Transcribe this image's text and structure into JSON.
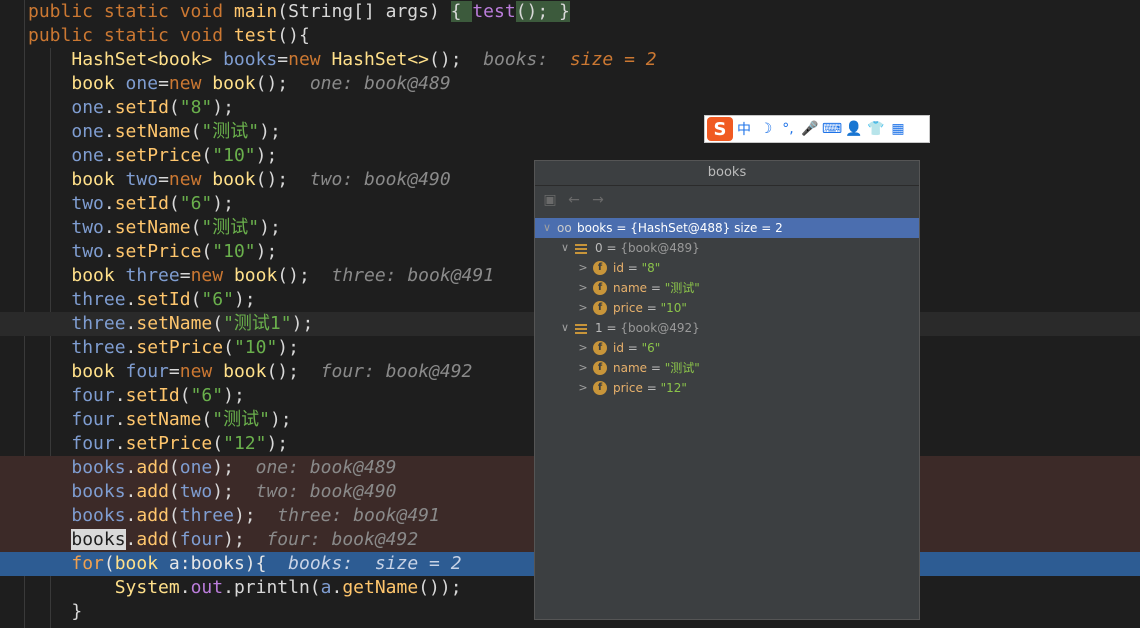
{
  "editor": {
    "lines": [
      {
        "cls": "",
        "tokens": [
          [
            "kw",
            "public "
          ],
          [
            "kw",
            "static "
          ],
          [
            "kw",
            "void "
          ],
          [
            "fn",
            "main"
          ],
          [
            "plain",
            "(String[] args) "
          ],
          [
            "fold-box",
            "{ "
          ],
          [
            "kw2",
            "test"
          ],
          [
            "fold-box",
            "();"
          ],
          [
            "fold-box",
            " }"
          ]
        ]
      },
      {
        "cls": "",
        "tokens": [
          [
            "kw",
            "public "
          ],
          [
            "kw",
            "static "
          ],
          [
            "kw",
            "void "
          ],
          [
            "fn",
            "test"
          ],
          [
            "plain",
            "(){"
          ]
        ]
      },
      {
        "cls": "",
        "tokens": [
          [
            "plain",
            "    "
          ],
          [
            "ty",
            "HashSet<book> "
          ],
          [
            "var",
            "books"
          ],
          [
            "plain",
            "="
          ],
          [
            "kw",
            "new "
          ],
          [
            "ty",
            "HashSet<>"
          ],
          [
            "plain",
            "();  "
          ],
          [
            "hint",
            "books:  "
          ],
          [
            "hint-hl",
            "size = 2"
          ]
        ]
      },
      {
        "cls": "",
        "tokens": [
          [
            "plain",
            "    "
          ],
          [
            "ty",
            "book "
          ],
          [
            "var",
            "one"
          ],
          [
            "plain",
            "="
          ],
          [
            "kw",
            "new "
          ],
          [
            "ty",
            "book"
          ],
          [
            "plain",
            "();  "
          ],
          [
            "hint",
            "one: book@489"
          ]
        ]
      },
      {
        "cls": "",
        "tokens": [
          [
            "plain",
            "    "
          ],
          [
            "var",
            "one"
          ],
          [
            "plain",
            "."
          ],
          [
            "fn",
            "setId"
          ],
          [
            "plain",
            "("
          ],
          [
            "str",
            "\"8\""
          ],
          [
            "plain",
            ");"
          ]
        ]
      },
      {
        "cls": "",
        "tokens": [
          [
            "plain",
            "    "
          ],
          [
            "var",
            "one"
          ],
          [
            "plain",
            "."
          ],
          [
            "fn",
            "setName"
          ],
          [
            "plain",
            "("
          ],
          [
            "str",
            "\"测试\""
          ],
          [
            "plain",
            ");"
          ]
        ]
      },
      {
        "cls": "",
        "tokens": [
          [
            "plain",
            "    "
          ],
          [
            "var",
            "one"
          ],
          [
            "plain",
            "."
          ],
          [
            "fn",
            "setPrice"
          ],
          [
            "plain",
            "("
          ],
          [
            "str",
            "\"10\""
          ],
          [
            "plain",
            ");"
          ]
        ]
      },
      {
        "cls": "",
        "tokens": [
          [
            "plain",
            "    "
          ],
          [
            "ty",
            "book "
          ],
          [
            "var",
            "two"
          ],
          [
            "plain",
            "="
          ],
          [
            "kw",
            "new "
          ],
          [
            "ty",
            "book"
          ],
          [
            "plain",
            "();  "
          ],
          [
            "hint",
            "two: book@490"
          ]
        ]
      },
      {
        "cls": "",
        "tokens": [
          [
            "plain",
            "    "
          ],
          [
            "var",
            "two"
          ],
          [
            "plain",
            "."
          ],
          [
            "fn",
            "setId"
          ],
          [
            "plain",
            "("
          ],
          [
            "str",
            "\"6\""
          ],
          [
            "plain",
            ");"
          ]
        ]
      },
      {
        "cls": "",
        "tokens": [
          [
            "plain",
            "    "
          ],
          [
            "var",
            "two"
          ],
          [
            "plain",
            "."
          ],
          [
            "fn",
            "setName"
          ],
          [
            "plain",
            "("
          ],
          [
            "str",
            "\"测试\""
          ],
          [
            "plain",
            ");"
          ]
        ]
      },
      {
        "cls": "",
        "tokens": [
          [
            "plain",
            "    "
          ],
          [
            "var",
            "two"
          ],
          [
            "plain",
            "."
          ],
          [
            "fn",
            "setPrice"
          ],
          [
            "plain",
            "("
          ],
          [
            "str",
            "\"10\""
          ],
          [
            "plain",
            ");"
          ]
        ]
      },
      {
        "cls": "",
        "tokens": [
          [
            "plain",
            "    "
          ],
          [
            "ty",
            "book "
          ],
          [
            "var",
            "three"
          ],
          [
            "plain",
            "="
          ],
          [
            "kw",
            "new "
          ],
          [
            "ty",
            "book"
          ],
          [
            "plain",
            "();  "
          ],
          [
            "hint",
            "three: book@491"
          ]
        ]
      },
      {
        "cls": "",
        "tokens": [
          [
            "plain",
            "    "
          ],
          [
            "var",
            "three"
          ],
          [
            "plain",
            "."
          ],
          [
            "fn",
            "setId"
          ],
          [
            "plain",
            "("
          ],
          [
            "str",
            "\"6\""
          ],
          [
            "plain",
            ");"
          ]
        ]
      },
      {
        "cls": "caret",
        "tokens": [
          [
            "plain",
            "    "
          ],
          [
            "var",
            "three"
          ],
          [
            "plain",
            "."
          ],
          [
            "fn",
            "setName"
          ],
          [
            "plain",
            "("
          ],
          [
            "str",
            "\"测试1\""
          ],
          [
            "plain",
            ");"
          ]
        ]
      },
      {
        "cls": "",
        "tokens": [
          [
            "plain",
            "    "
          ],
          [
            "var",
            "three"
          ],
          [
            "plain",
            "."
          ],
          [
            "fn",
            "setPrice"
          ],
          [
            "plain",
            "("
          ],
          [
            "str",
            "\"10\""
          ],
          [
            "plain",
            ");"
          ]
        ]
      },
      {
        "cls": "",
        "tokens": [
          [
            "plain",
            "    "
          ],
          [
            "ty",
            "book "
          ],
          [
            "var",
            "four"
          ],
          [
            "plain",
            "="
          ],
          [
            "kw",
            "new "
          ],
          [
            "ty",
            "book"
          ],
          [
            "plain",
            "();  "
          ],
          [
            "hint",
            "four: book@492"
          ]
        ]
      },
      {
        "cls": "",
        "tokens": [
          [
            "plain",
            "    "
          ],
          [
            "var",
            "four"
          ],
          [
            "plain",
            "."
          ],
          [
            "fn",
            "setId"
          ],
          [
            "plain",
            "("
          ],
          [
            "str",
            "\"6\""
          ],
          [
            "plain",
            ");"
          ]
        ]
      },
      {
        "cls": "",
        "tokens": [
          [
            "plain",
            "    "
          ],
          [
            "var",
            "four"
          ],
          [
            "plain",
            "."
          ],
          [
            "fn",
            "setName"
          ],
          [
            "plain",
            "("
          ],
          [
            "str",
            "\"测试\""
          ],
          [
            "plain",
            ");"
          ]
        ]
      },
      {
        "cls": "",
        "tokens": [
          [
            "plain",
            "    "
          ],
          [
            "var",
            "four"
          ],
          [
            "plain",
            "."
          ],
          [
            "fn",
            "setPrice"
          ],
          [
            "plain",
            "("
          ],
          [
            "str",
            "\"12\""
          ],
          [
            "plain",
            ");"
          ]
        ]
      },
      {
        "cls": "bp",
        "tokens": [
          [
            "plain",
            "    "
          ],
          [
            "var",
            "books"
          ],
          [
            "plain",
            "."
          ],
          [
            "fn",
            "add"
          ],
          [
            "plain",
            "("
          ],
          [
            "var",
            "one"
          ],
          [
            "plain",
            ");  "
          ],
          [
            "hint",
            "one: book@489"
          ]
        ]
      },
      {
        "cls": "bp",
        "tokens": [
          [
            "plain",
            "    "
          ],
          [
            "var",
            "books"
          ],
          [
            "plain",
            "."
          ],
          [
            "fn",
            "add"
          ],
          [
            "plain",
            "("
          ],
          [
            "var",
            "two"
          ],
          [
            "plain",
            ");  "
          ],
          [
            "hint",
            "two: book@490"
          ]
        ]
      },
      {
        "cls": "bp",
        "tokens": [
          [
            "plain",
            "    "
          ],
          [
            "var",
            "books"
          ],
          [
            "plain",
            "."
          ],
          [
            "fn",
            "add"
          ],
          [
            "plain",
            "("
          ],
          [
            "var",
            "three"
          ],
          [
            "plain",
            ");  "
          ],
          [
            "hint",
            "three: book@491"
          ]
        ]
      },
      {
        "cls": "bp",
        "tokens": [
          [
            "plain",
            "    "
          ],
          [
            "sel",
            "books"
          ],
          [
            "plain",
            "."
          ],
          [
            "fn",
            "add"
          ],
          [
            "plain",
            "("
          ],
          [
            "var",
            "four"
          ],
          [
            "plain",
            ");  "
          ],
          [
            "hint",
            "four: book@492"
          ]
        ]
      },
      {
        "cls": "exec",
        "tokens": [
          [
            "plain",
            "    "
          ],
          [
            "kw",
            "for"
          ],
          [
            "plain",
            "("
          ],
          [
            "ty",
            "book "
          ],
          [
            "var",
            "a"
          ],
          [
            "plain",
            ":"
          ],
          [
            "var",
            "books"
          ],
          [
            "plain",
            "){  "
          ],
          [
            "hint",
            "books:  size = 2"
          ]
        ]
      },
      {
        "cls": "",
        "tokens": [
          [
            "plain",
            "        "
          ],
          [
            "ty",
            "System"
          ],
          [
            "plain",
            "."
          ],
          [
            "kw2",
            "out"
          ],
          [
            "plain",
            "."
          ],
          [
            "plain",
            "println("
          ],
          [
            "var",
            "a"
          ],
          [
            "plain",
            "."
          ],
          [
            "fn",
            "getName"
          ],
          [
            "plain",
            "());"
          ]
        ]
      },
      {
        "cls": "",
        "tokens": [
          [
            "plain",
            "    }"
          ]
        ]
      }
    ]
  },
  "ime": {
    "logo": "S",
    "items": [
      {
        "name": "ime-chinese-mode",
        "glyph": "中"
      },
      {
        "name": "moon-icon",
        "glyph": "☽"
      },
      {
        "name": "punctuation-icon",
        "glyph": "°,"
      },
      {
        "name": "microphone-icon",
        "glyph": "🎤"
      },
      {
        "name": "keyboard-icon",
        "glyph": "⌨"
      },
      {
        "name": "user-icon",
        "glyph": "👤"
      },
      {
        "name": "shirt-icon",
        "glyph": "👕"
      },
      {
        "name": "apps-icon",
        "glyph": "▦"
      }
    ]
  },
  "popup": {
    "title": "books",
    "tree": [
      {
        "depth": 0,
        "toggle": "∨",
        "icon": "glasses",
        "name": "books",
        "eq": " = ",
        "value": "{HashSet@488}  size = 2",
        "selected": true
      },
      {
        "depth": 1,
        "toggle": "∨",
        "icon": "array",
        "name": "0",
        "eq": " = ",
        "value": "{book@489}",
        "selected": false
      },
      {
        "depth": 2,
        "toggle": ">",
        "icon": "field",
        "name": "id",
        "eq": " = ",
        "value": "\"8\"",
        "selected": false,
        "str": true
      },
      {
        "depth": 2,
        "toggle": ">",
        "icon": "field",
        "name": "name",
        "eq": " = ",
        "value": "\"测试\"",
        "selected": false,
        "str": true
      },
      {
        "depth": 2,
        "toggle": ">",
        "icon": "field",
        "name": "price",
        "eq": " = ",
        "value": "\"10\"",
        "selected": false,
        "str": true
      },
      {
        "depth": 1,
        "toggle": "∨",
        "icon": "array",
        "name": "1",
        "eq": " = ",
        "value": "{book@492}",
        "selected": false
      },
      {
        "depth": 2,
        "toggle": ">",
        "icon": "field",
        "name": "id",
        "eq": " = ",
        "value": "\"6\"",
        "selected": false,
        "str": true
      },
      {
        "depth": 2,
        "toggle": ">",
        "icon": "field",
        "name": "name",
        "eq": " = ",
        "value": "\"测试\"",
        "selected": false,
        "str": true
      },
      {
        "depth": 2,
        "toggle": ">",
        "icon": "field",
        "name": "price",
        "eq": " = ",
        "value": "\"12\"",
        "selected": false,
        "str": true
      }
    ]
  }
}
